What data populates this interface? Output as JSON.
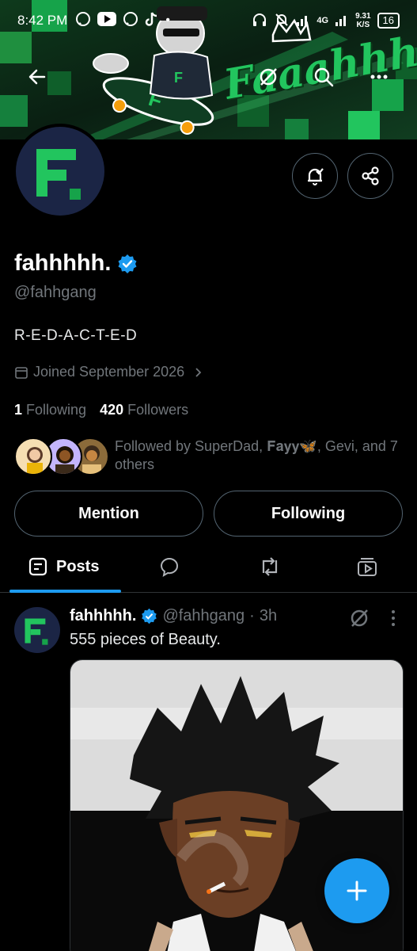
{
  "status_bar": {
    "time": "8:42 PM",
    "network": "4G",
    "speed_value": "9.31",
    "speed_unit": "K/S",
    "battery": "16"
  },
  "banner": {
    "text": "Faaahhhhh",
    "accent_color": "#22c55e"
  },
  "profile": {
    "name": "fahhhhh.",
    "verified": true,
    "handle": "@fahhgang",
    "bio": "R-E-D-A-C-T-E-D",
    "joined": "Joined September 2026",
    "following_count": "1",
    "following_label": "Following",
    "followers_count": "420",
    "followers_label": "Followers",
    "followed_by_text": "Followed by SuperDad, 𝐅𝐚𝐲𝐲🦋, Gevi, and 7 others"
  },
  "actions": {
    "mention_label": "Mention",
    "following_label": "Following"
  },
  "tabs": [
    {
      "label": "Posts",
      "icon": "posts-icon",
      "active": true
    },
    {
      "label": "",
      "icon": "replies-icon",
      "active": false
    },
    {
      "label": "",
      "icon": "reposts-icon",
      "active": false
    },
    {
      "label": "",
      "icon": "media-icon",
      "active": false
    }
  ],
  "post": {
    "author": "fahhhhh.",
    "handle": "@fahhgang",
    "separator": "·",
    "time": "3h",
    "text": "555 pieces of Beauty."
  },
  "colors": {
    "accent": "#1d9bf0",
    "brand_green": "#22c55e",
    "background": "#000000"
  }
}
